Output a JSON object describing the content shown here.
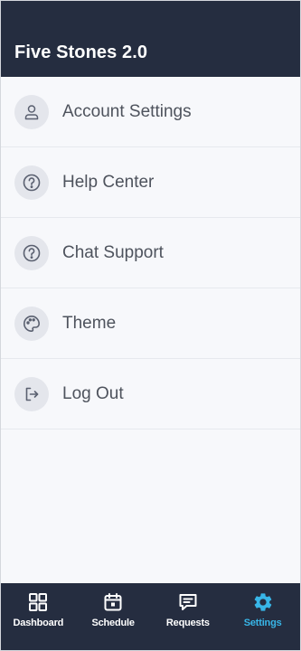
{
  "app": {
    "title": "Five Stones 2.0"
  },
  "menu": {
    "items": [
      {
        "label": "Account Settings",
        "icon": "user-icon"
      },
      {
        "label": "Help Center",
        "icon": "question-icon"
      },
      {
        "label": "Chat Support",
        "icon": "question-icon"
      },
      {
        "label": "Theme",
        "icon": "palette-icon"
      },
      {
        "label": "Log Out",
        "icon": "logout-icon"
      }
    ]
  },
  "bottom_nav": {
    "items": [
      {
        "label": "Dashboard",
        "icon": "grid-icon"
      },
      {
        "label": "Schedule",
        "icon": "calendar-icon"
      },
      {
        "label": "Requests",
        "icon": "chat-icon"
      },
      {
        "label": "Settings",
        "icon": "gear-icon",
        "active": true
      }
    ]
  },
  "colors": {
    "header_bg": "#252d40",
    "content_bg": "#f7f8fb",
    "accent_active": "#38b6e8",
    "label_text": "#4e535d"
  }
}
